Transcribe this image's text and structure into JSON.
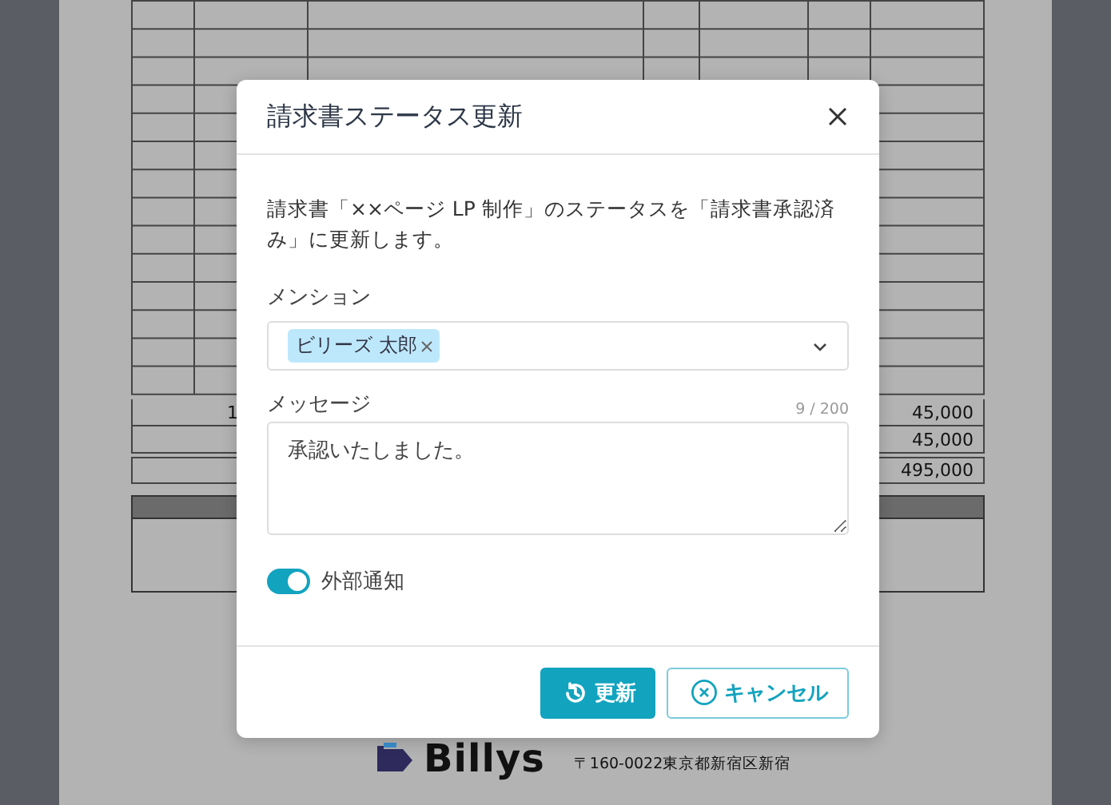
{
  "document": {
    "amount_rows": [
      {
        "column_1": "1",
        "amount": "45,000"
      },
      {
        "amount": "45,000"
      },
      {
        "amount": "495,000"
      }
    ],
    "company": {
      "name": "Billys",
      "address": "〒160-0022東京都新宿区新宿"
    }
  },
  "dialog": {
    "title": "請求書ステータス更新",
    "message": "請求書「××ページ LP 制作」のステータスを「請求書承認済み」に更新します。",
    "mention": {
      "label": "メンション",
      "tags": [
        {
          "label": "ビリーズ 太郎"
        }
      ]
    },
    "message_field": {
      "label": "メッセージ",
      "counter": "9 / 200",
      "value": "承認いたしました。"
    },
    "toggle": {
      "label": "外部通知",
      "on": true
    },
    "buttons": [
      {
        "kind": "primary",
        "label": "更新"
      },
      {
        "kind": "secondary",
        "label": "キャンセル"
      }
    ]
  }
}
